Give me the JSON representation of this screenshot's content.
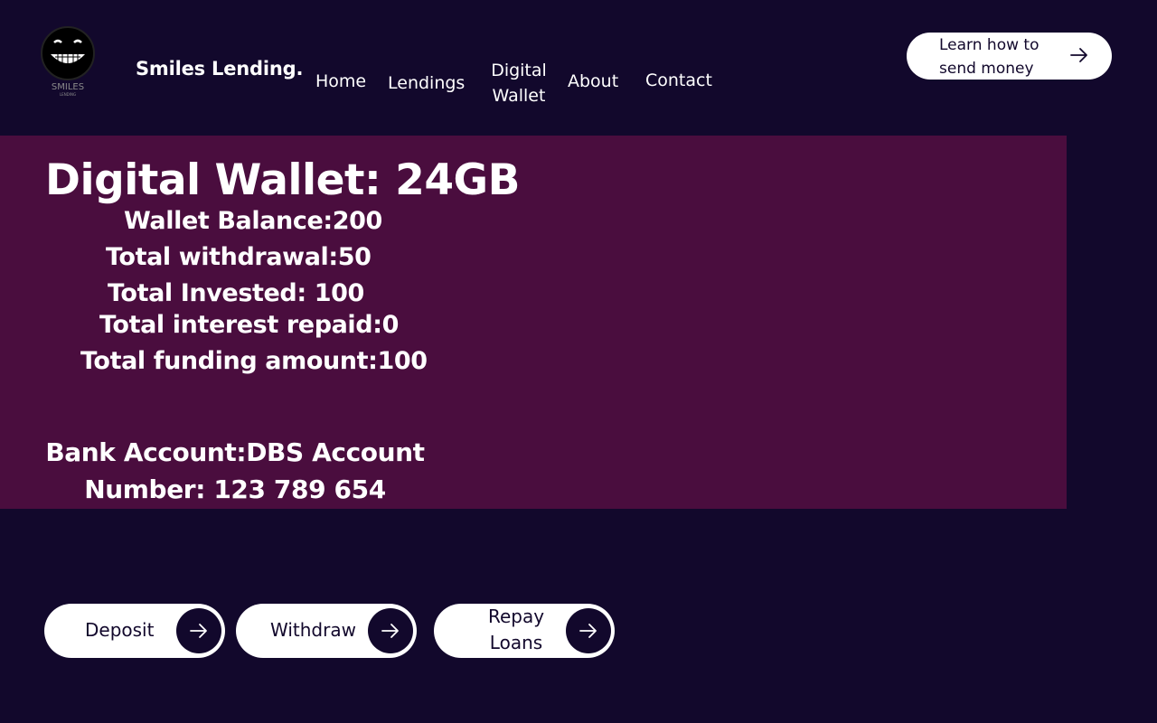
{
  "header": {
    "logo": {
      "text": "SMILES",
      "subtext": "LENDING"
    },
    "brand": "Smiles Lending.",
    "nav": {
      "home": "Home",
      "lendings": "Lendings",
      "digital_wallet": "Digital Wallet",
      "about": "About",
      "contact": "Contact"
    },
    "cta": {
      "label": "Learn how to send money",
      "icon": "arrow-right-icon"
    }
  },
  "wallet": {
    "title": "Digital Wallet: 24GB",
    "balance": "Wallet Balance:200",
    "withdrawal": "Total withdrawal:50",
    "invested": "Total Invested: 100",
    "interest_repaid": "Total interest repaid:0",
    "funding_amount": "Total funding amount:100",
    "bank_account": "Bank Account:DBS Account Number: 123 789 654"
  },
  "actions": {
    "deposit": "Deposit",
    "withdraw": "Withdraw",
    "repay": "Repay Loans"
  },
  "colors": {
    "background": "#12082c",
    "panel": "#4a0d3e",
    "button": "#ffffff",
    "button_text": "#12082c"
  }
}
